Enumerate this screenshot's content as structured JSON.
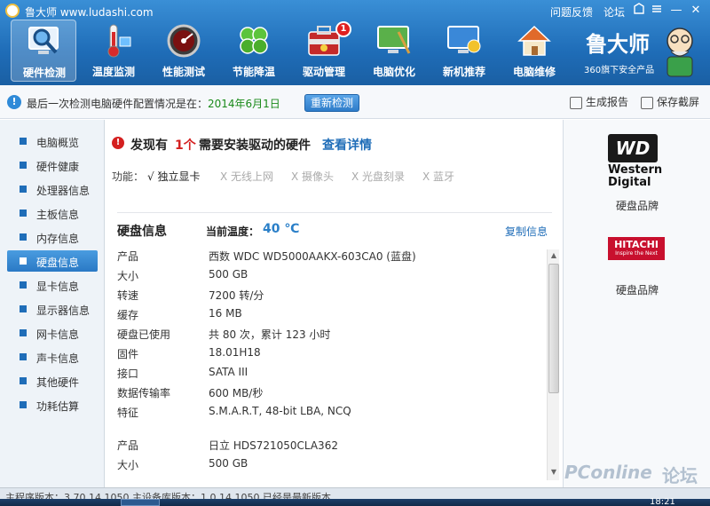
{
  "titlebar": {
    "app_name": "鲁大师 www.ludashi.com",
    "links": [
      "问题反馈",
      "论坛"
    ],
    "window_buttons": {
      "minimize": "—",
      "close": "✕"
    }
  },
  "nav": {
    "items": [
      {
        "label": "硬件检测",
        "icon": "magnifier-monitor-icon",
        "active": true
      },
      {
        "label": "温度监测",
        "icon": "thermometer-icon",
        "active": false
      },
      {
        "label": "性能测试",
        "icon": "speedometer-icon",
        "active": false
      },
      {
        "label": "节能降温",
        "icon": "clover-icon",
        "active": false
      },
      {
        "label": "驱动管理",
        "icon": "toolbox-icon",
        "active": false,
        "badge": "1"
      },
      {
        "label": "电脑优化",
        "icon": "monitor-broom-icon",
        "active": false
      },
      {
        "label": "新机推荐",
        "icon": "monitor-medal-icon",
        "active": false
      },
      {
        "label": "电脑维修",
        "icon": "house-icon",
        "active": false
      }
    ],
    "brand": {
      "logo_text": "鲁大师",
      "subtitle": "360旗下安全产品"
    }
  },
  "infobar": {
    "text": "最后一次检测电脑硬件配置情况是在：",
    "date": "2014年6月1日",
    "recheck_label": "重新检测",
    "report_label": "生成报告",
    "screenshot_label": "保存截屏"
  },
  "sidebar": {
    "items": [
      {
        "label": "电脑概览"
      },
      {
        "label": "硬件健康"
      },
      {
        "label": "处理器信息"
      },
      {
        "label": "主板信息"
      },
      {
        "label": "内存信息"
      },
      {
        "label": "硬盘信息",
        "active": true
      },
      {
        "label": "显卡信息"
      },
      {
        "label": "显示器信息"
      },
      {
        "label": "网卡信息"
      },
      {
        "label": "声卡信息"
      },
      {
        "label": "其他硬件"
      },
      {
        "label": "功耗估算"
      }
    ]
  },
  "main": {
    "warning": {
      "prefix": "发现有",
      "count": "1个",
      "suffix": "需要安装驱动的硬件",
      "link": "查看详情"
    },
    "functions": {
      "label": "功能：",
      "items": [
        {
          "label": "√ 独立显卡",
          "supported": true
        },
        {
          "label": "X 无线上网",
          "supported": false
        },
        {
          "label": "X 摄像头",
          "supported": false
        },
        {
          "label": "X 光盘刻录",
          "supported": false
        },
        {
          "label": "X 蓝牙",
          "supported": false
        }
      ]
    },
    "disk": {
      "title": "硬盘信息",
      "temp_label": "当前温度：",
      "temp_value": "40 ℃",
      "copy_label": "复制信息",
      "rows": [
        {
          "k": "产品",
          "v": "西数 WDC WD5000AAKX-603CA0 (蓝盘)"
        },
        {
          "k": "大小",
          "v": "500 GB"
        },
        {
          "k": "转速",
          "v": "7200 转/分"
        },
        {
          "k": "缓存",
          "v": "16 MB"
        },
        {
          "k": "硬盘已使用",
          "v": "共 80 次，累计 123 小时"
        },
        {
          "k": "固件",
          "v": "18.01H18"
        },
        {
          "k": "接口",
          "v": "SATA III"
        },
        {
          "k": "数据传输率",
          "v": "600 MB/秒"
        },
        {
          "k": "特征",
          "v": "S.M.A.R.T,  48-bit LBA,  NCQ"
        },
        {
          "k": "产品",
          "v": "日立  HDS721050CLA362"
        },
        {
          "k": "大小",
          "v": "500 GB"
        }
      ]
    }
  },
  "right": {
    "wd_box": "WD",
    "wd_text": "Western Digital",
    "wd_caption": "硬盘品牌",
    "hitachi_text": "HITACHI",
    "hitachi_sub": "Inspire the Next",
    "hitachi_caption": "硬盘品牌"
  },
  "status": {
    "text": "主程序版本：3.70.14.1050   主设备库版本：1.0.14.1050   已经是最新版本"
  },
  "taskbar": {
    "clock": "18:21"
  },
  "watermark": {
    "text": "PConline",
    "forum": "论坛"
  },
  "colors": {
    "accent": "#1f6db8",
    "warning": "#d42020",
    "date": "#1a8a1a",
    "temp": "#2a7fc8"
  }
}
